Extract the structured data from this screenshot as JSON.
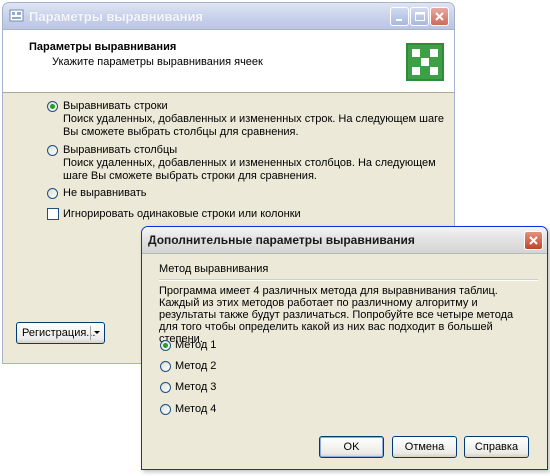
{
  "main_window": {
    "title": "Параметры выравнивания",
    "header_title": "Параметры выравнивания",
    "header_subtitle": "Укажите параметры выравнивания ячеек",
    "options": [
      {
        "label": "Выравнивать строки",
        "desc1": "Поиск удаленных, добавленных и измененных строк. На следующем шаге",
        "desc2": "Вы сможете выбрать столбцы для сравнения.",
        "selected": true
      },
      {
        "label": "Выравнивать столбцы",
        "desc1": "Поиск удаленных, добавленных и измененных столбцов. На следующем",
        "desc2": "шаге Вы сможете выбрать строки для сравнения.",
        "selected": false
      },
      {
        "label": "Не выравнивать",
        "selected": false
      }
    ],
    "ignore_checkbox": {
      "label": "Игнорировать одинаковые строки или колонки",
      "checked": false
    },
    "registration_button": "Регистрация..."
  },
  "dialog": {
    "title": "Дополнительные параметры выравнивания",
    "group_label": "Метод выравнивания",
    "description": "Программа имеет 4 различных метода для выравнивания таблиц. Каждый из этих методов работает по различному алгоритму и результаты также будут различаться. Попробуйте все четыре метода для того чтобы определить какой из них вас подходит в большей степени.",
    "methods": [
      {
        "label": "Метод 1",
        "selected": true
      },
      {
        "label": "Метод 2",
        "selected": false
      },
      {
        "label": "Метод 3",
        "selected": false
      },
      {
        "label": "Метод 4",
        "selected": false
      }
    ],
    "buttons": {
      "ok": "OK",
      "cancel": "Отмена",
      "help": "Справка"
    }
  },
  "colors": {
    "accent_green": "#21a121",
    "active_border": "#0831d9",
    "window_bg": "#ece9d8"
  },
  "icons": [
    "app-icon",
    "minimize-icon",
    "maximize-icon",
    "close-icon",
    "logo-icon",
    "dropdown-arrow-icon"
  ]
}
